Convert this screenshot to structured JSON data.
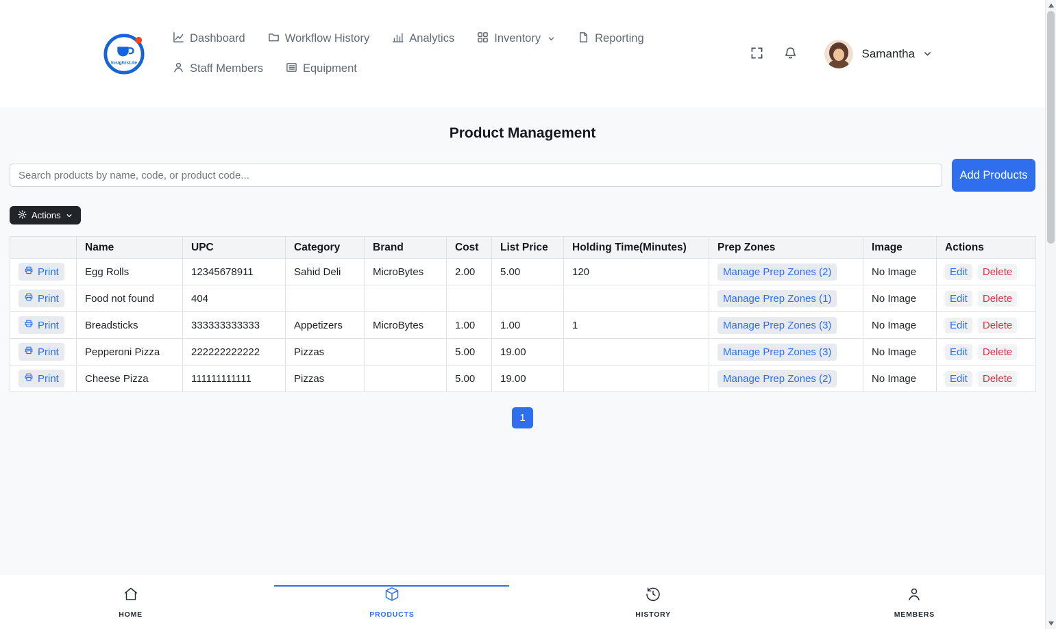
{
  "header": {
    "brand": "InsightsLite",
    "nav": [
      {
        "label": "Dashboard",
        "icon": "line-chart-icon"
      },
      {
        "label": "Workflow History",
        "icon": "folder-icon"
      },
      {
        "label": "Analytics",
        "icon": "bar-chart-icon"
      },
      {
        "label": "Inventory",
        "icon": "grid-icon",
        "has_dropdown": true
      },
      {
        "label": "Reporting",
        "icon": "file-icon"
      },
      {
        "label": "Staff Members",
        "icon": "person-icon"
      },
      {
        "label": "Equipment",
        "icon": "list-icon"
      }
    ],
    "user": {
      "name": "Samantha"
    }
  },
  "page": {
    "title": "Product Management",
    "search_placeholder": "Search products by name, code, or product code...",
    "add_button": "Add Products",
    "actions_button": "Actions"
  },
  "table": {
    "headers": [
      "",
      "Name",
      "UPC",
      "Category",
      "Brand",
      "Cost",
      "List Price",
      "Holding Time(Minutes)",
      "Prep Zones",
      "Image",
      "Actions"
    ],
    "print_label": "Print",
    "edit_label": "Edit",
    "delete_label": "Delete",
    "rows": [
      {
        "name": "Egg Rolls",
        "upc": "12345678911",
        "category": "Sahid Deli",
        "brand": "MicroBytes",
        "cost": "2.00",
        "list_price": "5.00",
        "holding_time": "120",
        "prep_zones": "Manage Prep Zones (2)",
        "image": "No Image"
      },
      {
        "name": "Food not found",
        "upc": "404",
        "category": "",
        "brand": "",
        "cost": "",
        "list_price": "",
        "holding_time": "",
        "prep_zones": "Manage Prep Zones (1)",
        "image": "No Image"
      },
      {
        "name": "Breadsticks",
        "upc": "333333333333",
        "category": "Appetizers",
        "brand": "MicroBytes",
        "cost": "1.00",
        "list_price": "1.00",
        "holding_time": "1",
        "prep_zones": "Manage Prep Zones (3)",
        "image": "No Image"
      },
      {
        "name": "Pepperoni Pizza",
        "upc": "222222222222",
        "category": "Pizzas",
        "brand": "",
        "cost": "5.00",
        "list_price": "19.00",
        "holding_time": "",
        "prep_zones": "Manage Prep Zones (3)",
        "image": "No Image"
      },
      {
        "name": "Cheese Pizza",
        "upc": "111111111111",
        "category": "Pizzas",
        "brand": "",
        "cost": "5.00",
        "list_price": "19.00",
        "holding_time": "",
        "prep_zones": "Manage Prep Zones (2)",
        "image": "No Image"
      }
    ]
  },
  "pagination": {
    "current": "1"
  },
  "bottom_nav": [
    {
      "label": "HOME",
      "icon": "house-icon",
      "active": false
    },
    {
      "label": "PRODUCTS",
      "icon": "cube-icon",
      "active": true
    },
    {
      "label": "HISTORY",
      "icon": "history-icon",
      "active": false
    },
    {
      "label": "MEMBERS",
      "icon": "person-icon",
      "active": false
    }
  ],
  "colors": {
    "primary": "#2f6fed",
    "danger": "#dc3545",
    "dark": "#212529"
  }
}
